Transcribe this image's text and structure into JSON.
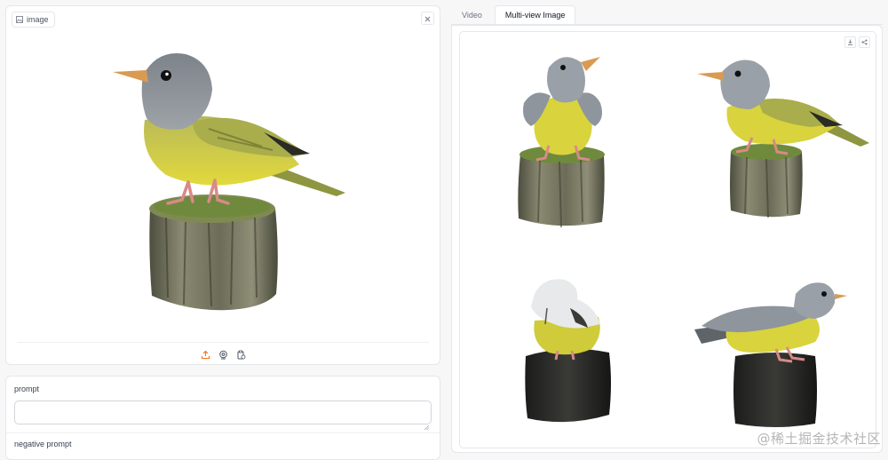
{
  "image_panel": {
    "label": "image",
    "icons": [
      "image-icon",
      "close-icon",
      "upload-icon",
      "webcam-icon",
      "clipboard-icon"
    ]
  },
  "prompt": {
    "label": "prompt",
    "value": "",
    "placeholder": ""
  },
  "negative_prompt": {
    "label": "negative prompt"
  },
  "tabs": [
    {
      "label": "Video",
      "active": false
    },
    {
      "label": "Multi-view Image",
      "active": true
    }
  ],
  "gallery": {
    "actions": [
      "download-icon",
      "share-icon"
    ],
    "views": [
      "front-view",
      "three-quarter-view",
      "back-view",
      "side-view"
    ]
  },
  "watermark": "@稀土掘金技术社区",
  "colors": {
    "accent": "#f97316",
    "bird_head": "#8d9298",
    "bird_breast": "#d6d34a",
    "bird_back": "#a8ad4a",
    "stump": "#6b6b58",
    "moss": "#6f8a3d"
  }
}
